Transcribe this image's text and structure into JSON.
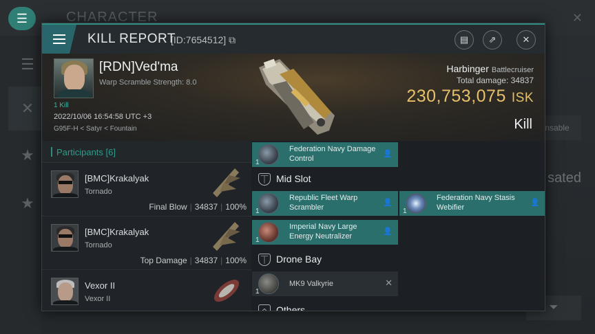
{
  "background": {
    "title": "CHARACTER",
    "right_text": "sated",
    "right_button": "nsable"
  },
  "dialog": {
    "title": "KILL REPORT",
    "id_text": "[ID:7654512]",
    "header_buttons": [
      "clipboard-icon",
      "external-link-icon",
      "close-icon"
    ]
  },
  "victim": {
    "name": "[RDN]Ved'ma",
    "warp_scramble": "Warp Scramble Strength: 8.0",
    "kills": "1 Kill",
    "datetime": "2022/10/06 16:54:58 UTC +3",
    "location": "G95F-H < Satyr < Fountain",
    "ship_name": "Harbinger",
    "ship_class": "Battlecruiser",
    "total_damage_label": "Total damage:",
    "total_damage": "34837",
    "isk_value": "230,753,075",
    "isk_unit": "ISK",
    "result": "Kill"
  },
  "participants": {
    "header": "Participants [6]",
    "rows": [
      {
        "name": "[BMC]Krakalyak",
        "ship": "Tornado",
        "role": "Final Blow",
        "damage": "34837",
        "percent": "100%"
      },
      {
        "name": "[BMC]Krakalyak",
        "ship": "Tornado",
        "role": "Top Damage",
        "damage": "34837",
        "percent": "100%"
      },
      {
        "name": "Vexor II",
        "ship": "Vexor II",
        "role": "",
        "damage": "",
        "percent": ""
      }
    ]
  },
  "modules": {
    "low_item": {
      "qty": "1",
      "name": "Federation Navy Damage Control"
    },
    "mid_slot_label": "Mid Slot",
    "mid_items": [
      {
        "qty": "1",
        "name": "Republic Fleet Warp Scrambler"
      },
      {
        "qty": "1",
        "name": "Federation Navy Stasis Webifier"
      },
      {
        "qty": "1",
        "name": "Imperial Navy Large Energy Neutralizer"
      }
    ],
    "drone_bay_label": "Drone Bay",
    "drone_item": {
      "qty": "1",
      "name": "MK9 Valkyrie"
    },
    "others_label": "Others"
  }
}
